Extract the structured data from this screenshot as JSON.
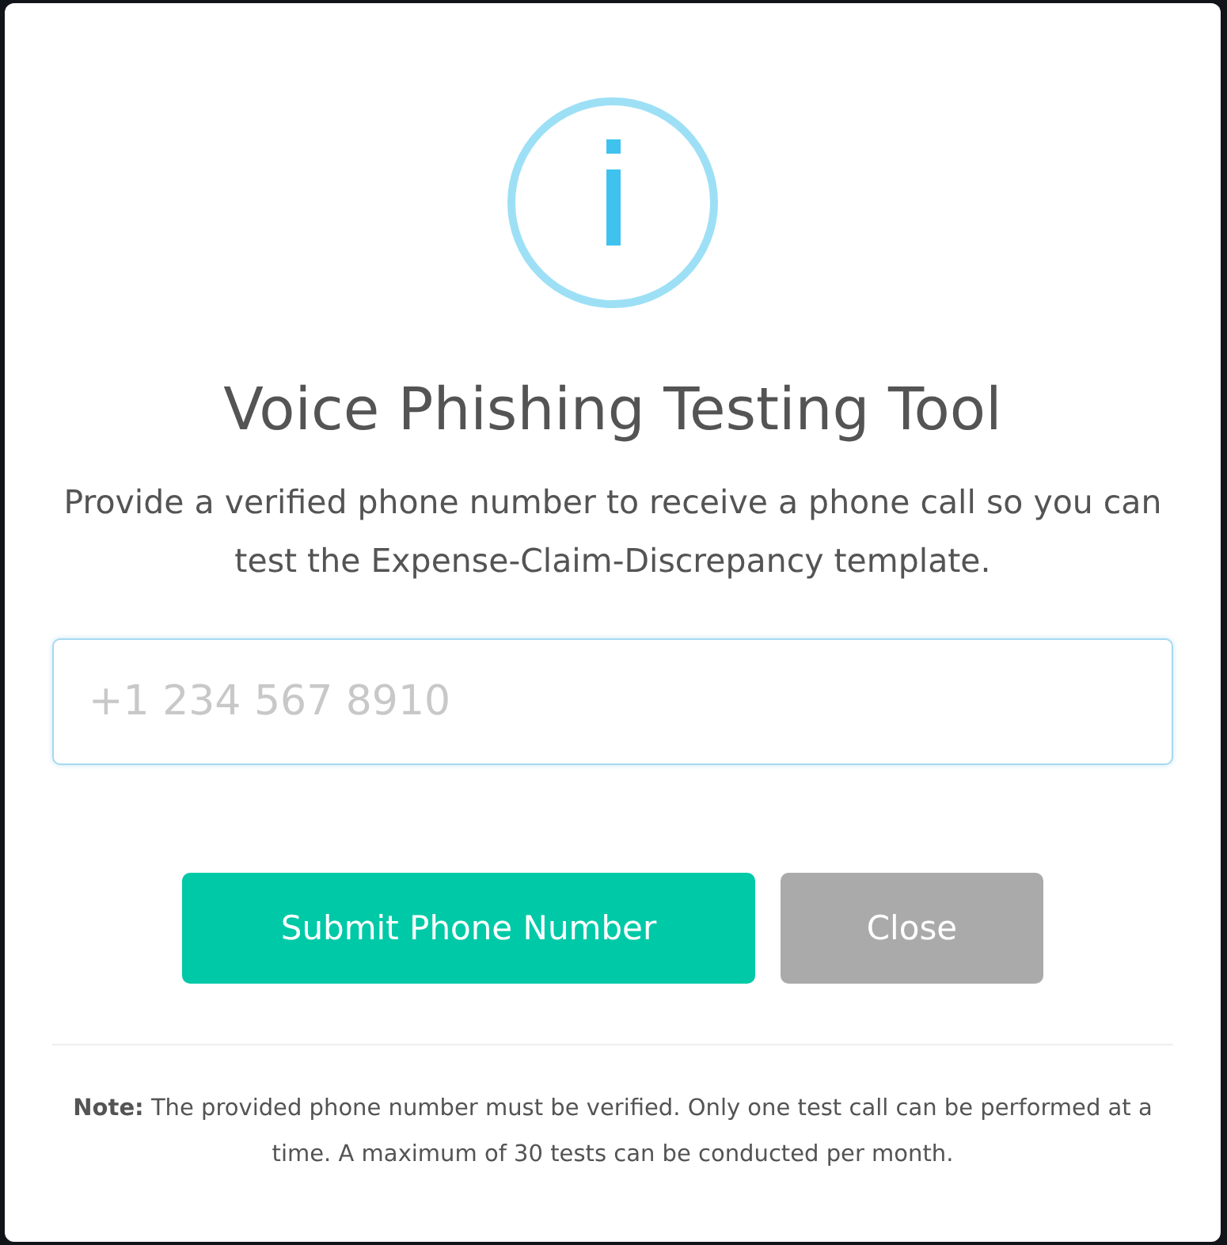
{
  "dialog": {
    "title": "Voice Phishing Testing Tool",
    "message": "Provide a verified phone number to receive a phone call so you can test the Expense-Claim-Discrepancy template.",
    "phone_field": {
      "placeholder": "+1 234 567 8910"
    },
    "buttons": [
      {
        "kind": "primary",
        "label": "Submit Phone Number"
      },
      {
        "kind": "secondary",
        "label": "Close"
      }
    ],
    "note": "**Note:** The provided phone number must be verified. Only one test call can be performed at a time. A maximum of 30 tests can be conducted per month."
  }
}
